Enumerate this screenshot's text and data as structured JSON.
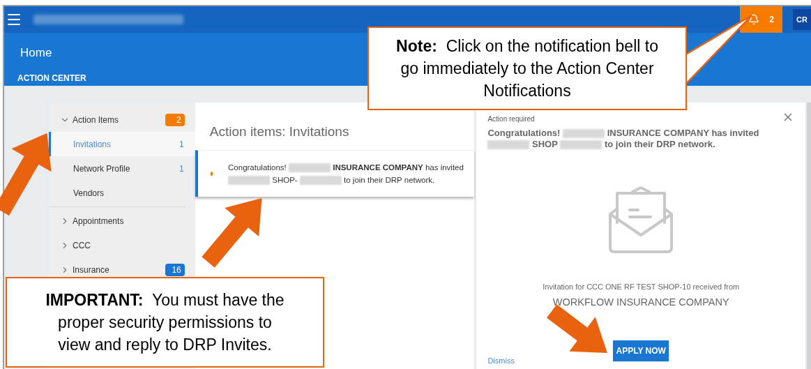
{
  "top_bar": {
    "notifications": {
      "count": "2"
    },
    "user_initials": "CR"
  },
  "header": {
    "title": "Home",
    "tabs": [
      {
        "label": "ACTION CENTER",
        "selected": true
      }
    ]
  },
  "sidebar": {
    "groups": [
      {
        "label": "Action Items",
        "expanded": true,
        "badge": {
          "text": "2",
          "color": "#f57c00"
        },
        "children": [
          {
            "label": "Invitations",
            "count": "1",
            "selected": true
          },
          {
            "label": "Network Profile",
            "count": "1",
            "selected": false
          },
          {
            "label": "Vendors",
            "selected": false
          }
        ]
      },
      {
        "label": "Appointments",
        "expanded": false
      },
      {
        "label": "CCC",
        "expanded": false
      },
      {
        "label": "Insurance",
        "expanded": false,
        "badge": {
          "text": "16",
          "color": "#1976d2"
        }
      }
    ]
  },
  "list_panel": {
    "title": "Action items: Invitations",
    "items": [
      {
        "unread": true,
        "selected": true,
        "message": [
          {
            "kind": "text",
            "text": "Congratulations!"
          },
          {
            "kind": "redacted"
          },
          {
            "kind": "bold",
            "text": "INSURANCE COMPANY"
          },
          {
            "kind": "text",
            "text": "has invited"
          },
          {
            "kind": "redacted"
          },
          {
            "kind": "text",
            "text": "SHOP-"
          },
          {
            "kind": "redacted"
          },
          {
            "kind": "text",
            "text": "to join their DRP network."
          }
        ]
      }
    ]
  },
  "detail_panel": {
    "label": "Action required",
    "message": [
      {
        "kind": "text",
        "text": "Congratulations!"
      },
      {
        "kind": "redacted"
      },
      {
        "kind": "text",
        "text": "INSURANCE COMPANY has invited"
      },
      {
        "kind": "redacted"
      },
      {
        "kind": "text",
        "text": "SHOP"
      },
      {
        "kind": "redacted"
      },
      {
        "kind": "text",
        "text": "to join their DRP network."
      }
    ],
    "invitation_text": "Invitation for CCC ONE RF TEST SHOP-10 received from",
    "company": "WORKFLOW INSURANCE COMPANY",
    "primary_button": "APPLY NOW",
    "dismiss_link": "Dismiss"
  },
  "annotations": [
    {
      "kind": "note",
      "text": "**Note:**  Click on the notification bell to go immediately to the Action Center Notifications"
    },
    {
      "kind": "important",
      "text": "**IMPORTANT:**  You must have the proper security permissions to view and reply to DRP Invites."
    }
  ]
}
